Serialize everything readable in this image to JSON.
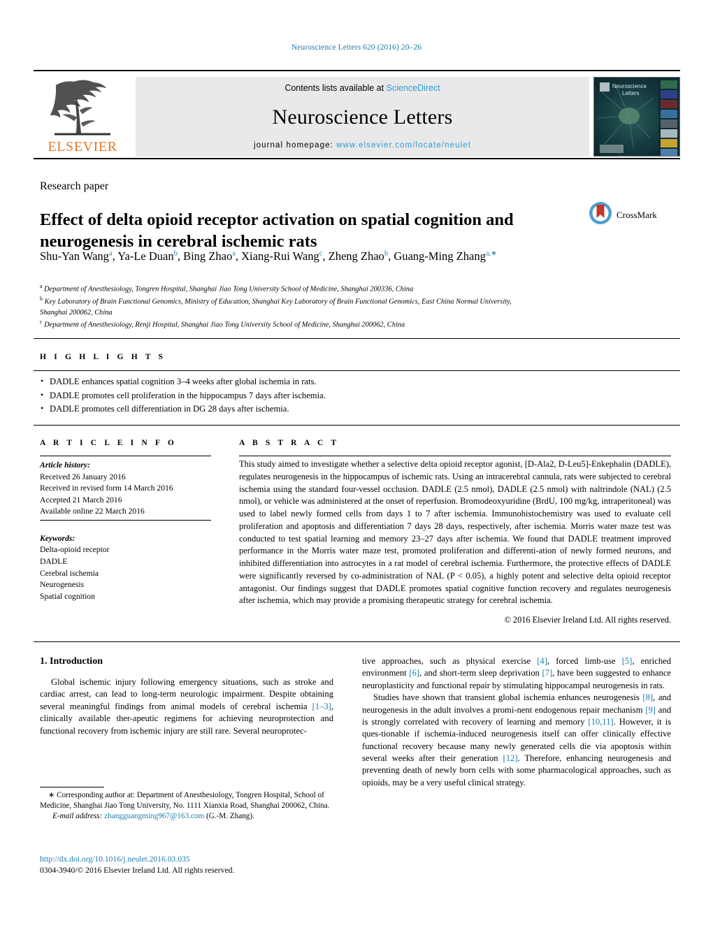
{
  "running_head": "Neuroscience Letters 620 (2016) 20–26",
  "masthead": {
    "publisher_name": "ELSEVIER",
    "publisher_logo_icon": "elsevier-tree-icon",
    "contents_prefix": "Contents lists available at ",
    "contents_link": "ScienceDirect",
    "journal_title": "Neuroscience Letters",
    "homepage_prefix": "journal homepage: ",
    "homepage_url": "www.elsevier.com/locate/neulet",
    "cover_title_line1": "Neuroscience",
    "cover_title_line2": "Letters"
  },
  "article": {
    "type": "Research paper",
    "title": "Effect of delta opioid receptor activation on spatial cognition and neurogenesis in cerebral ischemic rats",
    "crossmark_label": "CrossMark",
    "authors": [
      {
        "name": "Shu-Yan Wang",
        "marks": "a",
        "sep": ", "
      },
      {
        "name": "Ya-Le Duan",
        "marks": "b",
        "sep": ", "
      },
      {
        "name": "Bing Zhao",
        "marks": "a",
        "sep": ", "
      },
      {
        "name": "Xiang-Rui Wang",
        "marks": "c",
        "sep": ", "
      },
      {
        "name": "Zheng Zhao",
        "marks": "b",
        "sep": ", "
      },
      {
        "name": "Guang-Ming Zhang",
        "marks": "a,∗",
        "sep": ""
      }
    ],
    "affiliations": [
      {
        "mark": "a",
        "text": "Department of Anesthesiology, Tongren Hospital, Shanghai Jiao Tong University School of Medicine, Shanghai 200336, China"
      },
      {
        "mark": "b",
        "text": "Key Laboratory of Brain Functional Genomics, Ministry of Education, Shanghai Key Laboratory of Brain Functional Genomics, East China Normal University, Shanghai 200062, China"
      },
      {
        "mark": "c",
        "text": "Department of Anesthesiology, Renji Hospital, Shanghai Jiao Tong University School of Medicine, Shanghai 200062, China"
      }
    ]
  },
  "highlights": {
    "label": "H I G H L I G H T S",
    "items": [
      "DADLE enhances spatial cognition 3–4 weeks after global ischemia in rats.",
      "DADLE promotes cell proliferation in the hippocampus 7 days after ischemia.",
      "DADLE promotes cell differentiation in DG 28 days after ischemia."
    ]
  },
  "article_info": {
    "label": "A R T I C L E   I N F O",
    "history_label": "Article history:",
    "history": [
      "Received 26 January 2016",
      "Received in revised form 14 March 2016",
      "Accepted 21 March 2016",
      "Available online 22 March 2016"
    ],
    "keywords_label": "Keywords:",
    "keywords": [
      "Delta-opioid receptor",
      "DADLE",
      "Cerebral ischemia",
      "Neurogenesis",
      "Spatial cognition"
    ]
  },
  "abstract": {
    "label": "A B S T R A C T",
    "text": "This study aimed to investigate whether a selective delta opioid receptor agonist, [D-Ala2, D-Leu5]-Enkephalin (DADLE), regulates neurogenesis in the hippocampus of ischemic rats. Using an intracerebral cannula, rats were subjected to cerebral ischemia using the standard four-vessel occlusion. DADLE (2.5 nmol), DADLE (2.5 nmol) with naltrindole (NAL) (2.5 nmol), or vehicle was administered at the onset of reperfusion. Bromodeoxyuridine (BrdU, 100 mg/kg, intraperitoneal) was used to label newly formed cells from days 1 to 7 after ischemia. Immunohistochemistry was used to evaluate cell proliferation and apoptosis and differentiation 7 days 28 days, respectively, after ischemia. Morris water maze test was conducted to test spatial learning and memory 23–27 days after ischemia. We found that DADLE treatment improved performance in the Morris water maze test, promoted proliferation and differenti-ation of newly formed neurons, and inhibited differentiation into astrocytes in a rat model of cerebral ischemia. Furthermore, the protective effects of DADLE were significantly reversed by co-administration of NAL (P < 0.05), a highly potent and selective delta opioid receptor antagonist. Our findings suggest that DADLE promotes spatial cognitive function recovery and regulates neurogenesis after ischemia, which may provide a promising therapeutic strategy for cerebral ischemia.",
    "copyright": "© 2016 Elsevier Ireland Ltd. All rights reserved."
  },
  "body": {
    "intro_heading": "1. Introduction",
    "left_paragraph_1_parts": [
      {
        "t": "Global ischemic injury following emergency situations, such as stroke and cardiac arrest, can lead to long-term neurologic impairment. Despite obtaining several meaningful findings from animal models of cerebral ischemia ",
        "ref": false
      },
      {
        "t": "[1–3]",
        "ref": true
      },
      {
        "t": ", clinically available ther-apeutic regimens for achieving neuroprotection and functional recovery from ischemic injury are still rare. Several neuroprotec-",
        "ref": false
      }
    ],
    "right_paragraph_1_parts": [
      {
        "t": "tive approaches, such as physical exercise ",
        "ref": false
      },
      {
        "t": "[4]",
        "ref": true
      },
      {
        "t": ", forced limb-use ",
        "ref": false
      },
      {
        "t": "[5]",
        "ref": true
      },
      {
        "t": ", enriched environment ",
        "ref": false
      },
      {
        "t": "[6]",
        "ref": true
      },
      {
        "t": ", and short-term sleep deprivation ",
        "ref": false
      },
      {
        "t": "[7]",
        "ref": true
      },
      {
        "t": ", have been suggested to enhance neuroplasticity and functional repair by stimulating hippocampal neurogenesis in rats.",
        "ref": false
      }
    ],
    "right_paragraph_2_parts": [
      {
        "t": "Studies have shown that transient global ischemia enhances neurogenesis ",
        "ref": false
      },
      {
        "t": "[8]",
        "ref": true
      },
      {
        "t": ", and neurogenesis in the adult involves a promi-nent endogenous repair mechanism ",
        "ref": false
      },
      {
        "t": "[9]",
        "ref": true
      },
      {
        "t": " and is strongly correlated with recovery of learning and memory ",
        "ref": false
      },
      {
        "t": "[10,11]",
        "ref": true
      },
      {
        "t": ". However, it is ques-tionable if ischemia-induced neurogenesis itself can offer clinically effective functional recovery because many newly generated cells die via apoptosis within several weeks after their generation ",
        "ref": false
      },
      {
        "t": "[12]",
        "ref": true
      },
      {
        "t": ". Therefore, enhancing neurogenesis and preventing death of newly born cells with some pharmacological approaches, such as opioids, may be a very useful clinical strategy.",
        "ref": false
      }
    ]
  },
  "footer": {
    "corresponding_marker": "∗",
    "corresponding_text": "Corresponding author at: Department of Anesthesiology, Tongren Hospital, School of Medicine, Shanghai Jiao Tong University, No. 1111 Xianxia Road, Shanghai 200062, China.",
    "email_label": "E-mail address:",
    "email": "zhangguangming967@163.com",
    "email_suffix": "(G.-M. Zhang).",
    "doi_url": "http://dx.doi.org/10.1016/j.neulet.2016.03.035",
    "issn_line": "0304-3940/© 2016 Elsevier Ireland Ltd. All rights reserved."
  },
  "colors": {
    "link_blue": "#1b7ca8",
    "science_direct_blue": "#2b9bd4",
    "elsevier_orange": "#e87722"
  }
}
